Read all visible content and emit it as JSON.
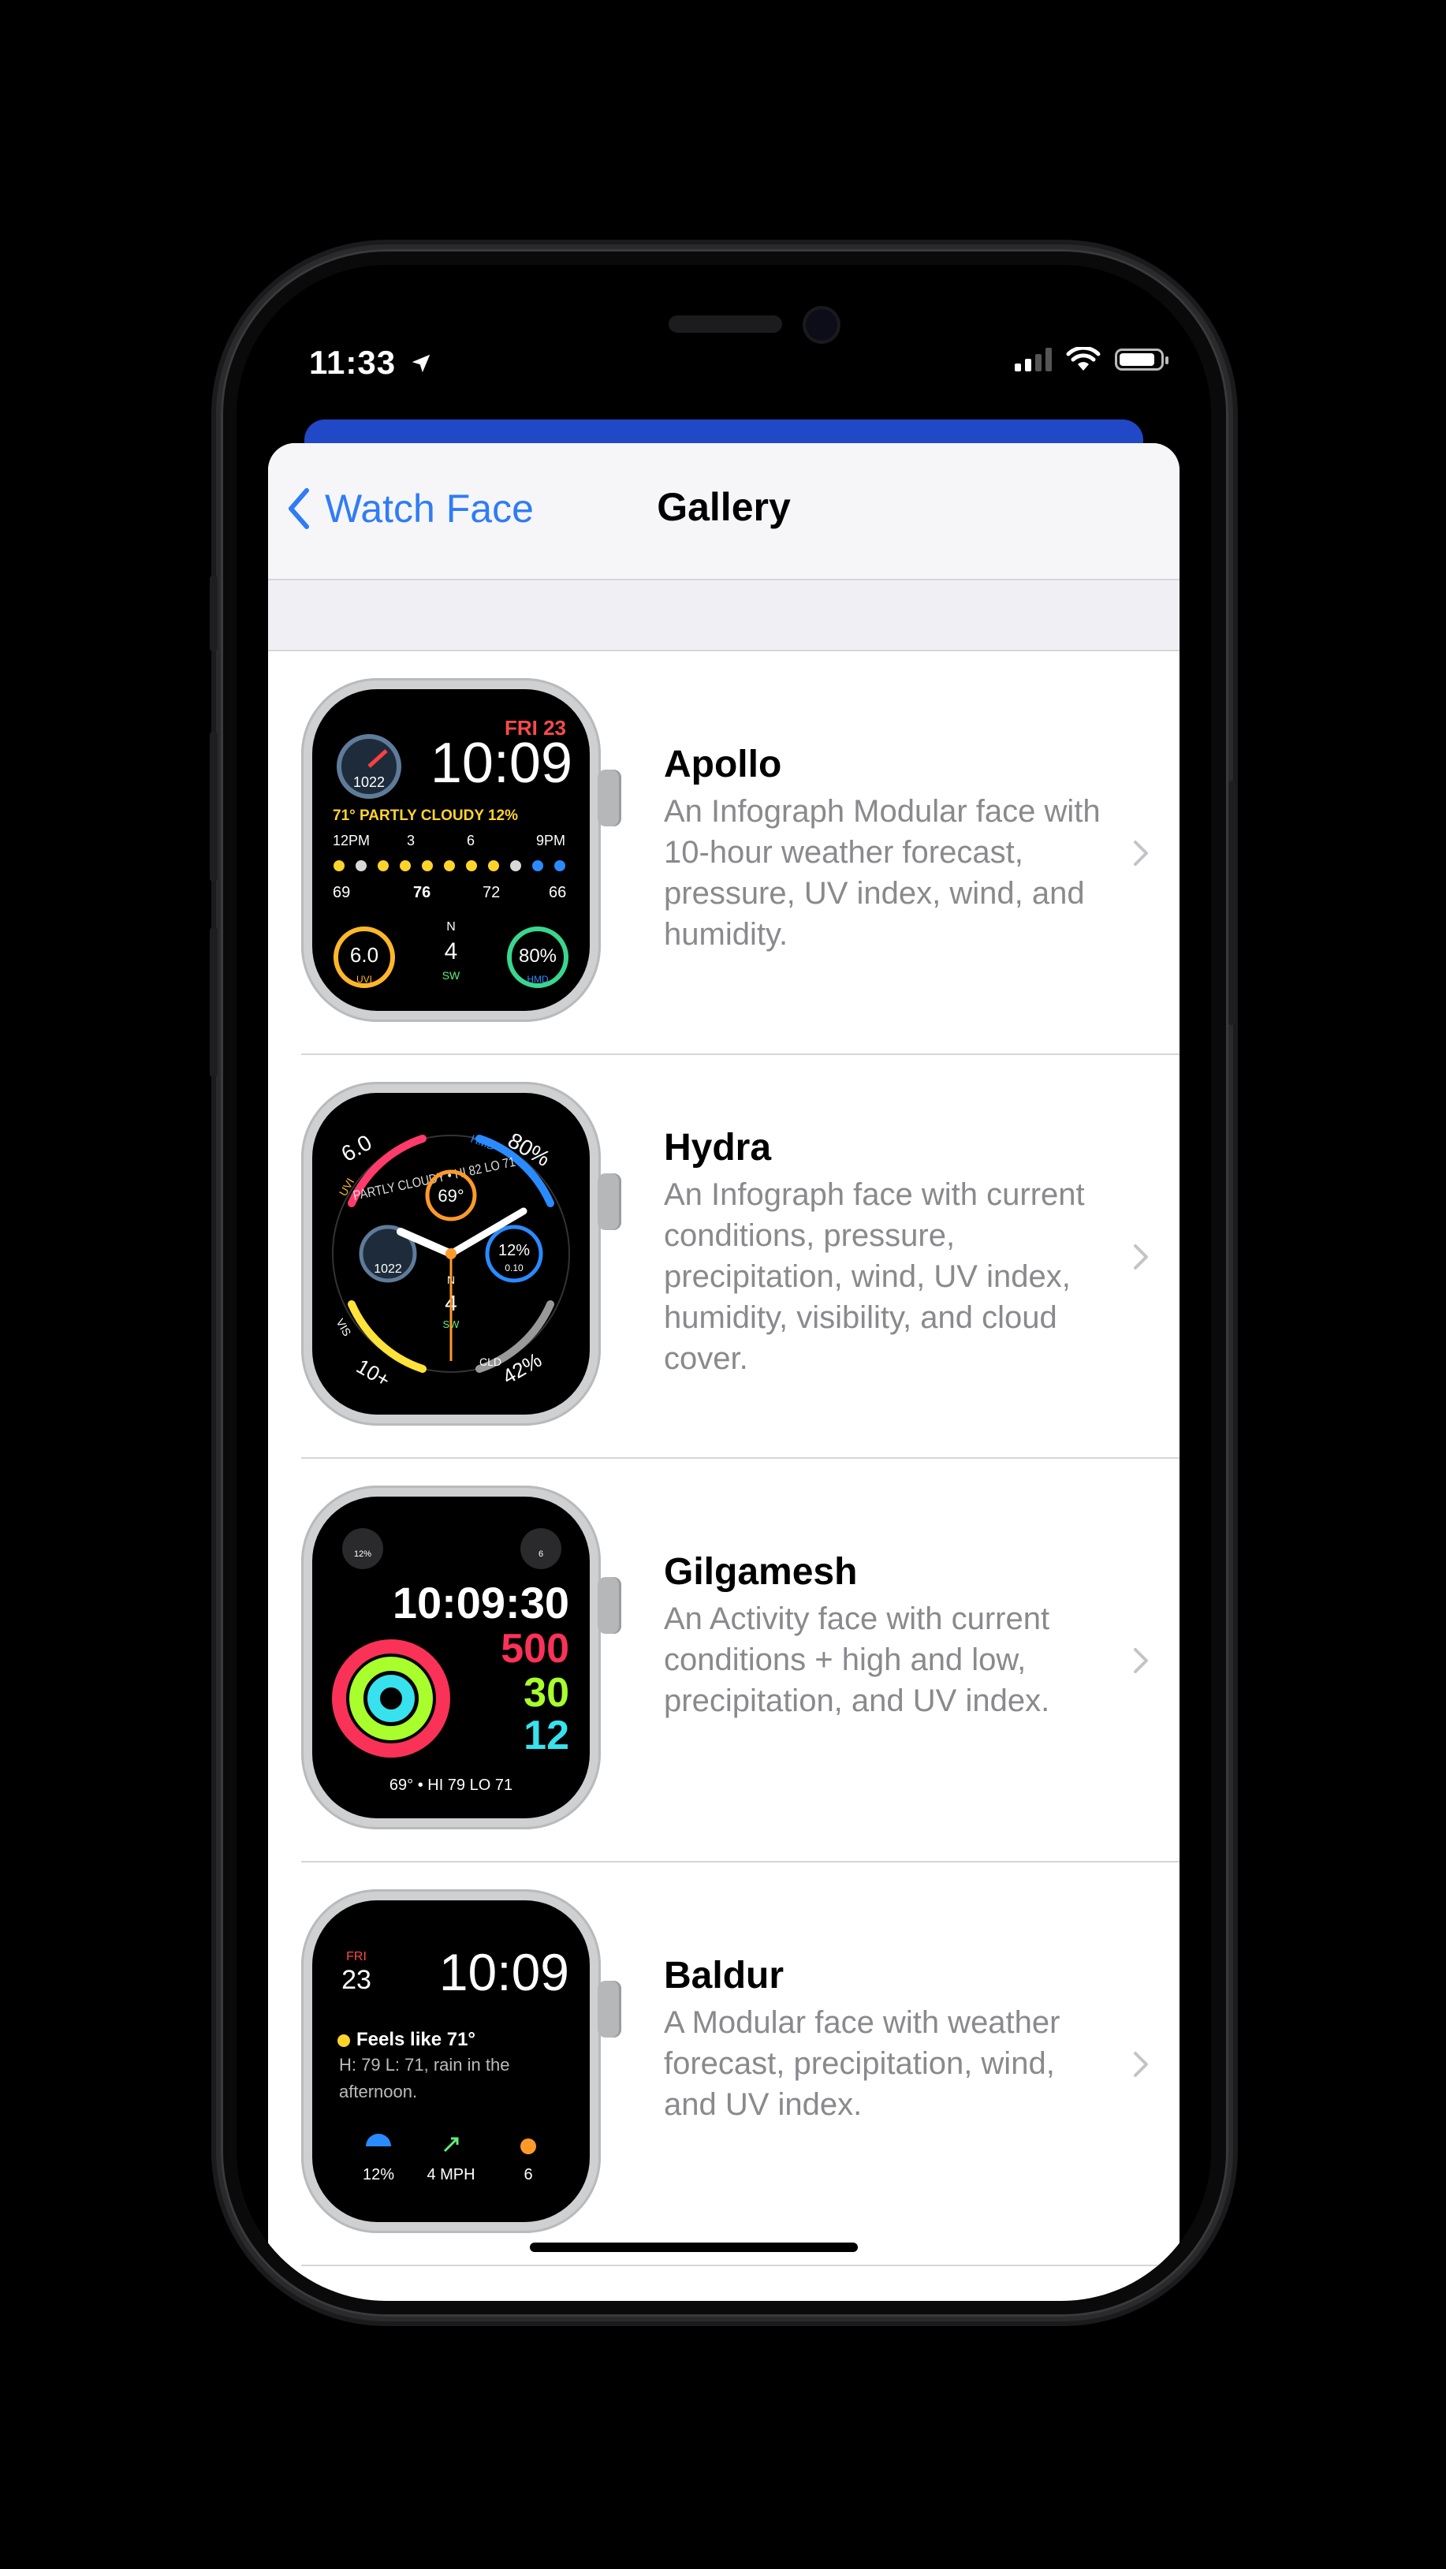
{
  "status_bar": {
    "time": "11:33"
  },
  "nav": {
    "back_label": "Watch Face",
    "title": "Gallery"
  },
  "faces": [
    {
      "title": "Apollo",
      "description": "An Infograph Modular face with 10-hour weather forecast, pressure, UV index, wind, and humidity.",
      "watch": {
        "date": "FRI 23",
        "time": "10:09",
        "pressure": "1022",
        "condition": "71° PARTLY CLOUDY 12%",
        "hours": [
          "12PM",
          "3",
          "6",
          "9PM"
        ],
        "temps": [
          "69",
          "76",
          "72",
          "66"
        ],
        "uv": "6.0",
        "uv_label": "UVI",
        "wind": "4",
        "wind_dir": "SW",
        "humidity": "80%",
        "humidity_label": "HMD",
        "compass_n": "N"
      }
    },
    {
      "title": "Hydra",
      "description": "An Infograph face with current conditions, pressure, precipitation, wind, UV index, humidity, visibility, and cloud cover.",
      "watch": {
        "uv": "6.0",
        "humidity": "80%",
        "arc_text": "PARTLY CLOUDY • HI 82 LO 71",
        "temp": "69°",
        "pressure": "1022",
        "precip": "12%",
        "precip_sub": "0.10",
        "wind": "4",
        "wind_dir": "SW",
        "visibility": "10+",
        "cloud": "42%",
        "uv_label": "UVI",
        "hmd_label": "HMD",
        "vis_label": "VIS",
        "cld_label": "CLD",
        "compass_n": "N"
      }
    },
    {
      "title": "Gilgamesh",
      "description": "An Activity face with current conditions + high and low, precipitation, and UV index.",
      "watch": {
        "time": "10:09:30",
        "move": "500",
        "exercise": "30",
        "stand": "12",
        "precip": "12%",
        "uv": "6",
        "weather": "69° • HI 79 LO 71"
      }
    },
    {
      "title": "Baldur",
      "description": "A Modular face with weather forecast, precipitation, wind, and UV index.",
      "watch": {
        "day": "FRI",
        "date": "23",
        "time": "10:09",
        "feels": "Feels like 71°",
        "forecast": "H: 79 L: 71, rain in the afternoon.",
        "precip": "12%",
        "wind": "4 MPH",
        "uv": "6"
      }
    }
  ],
  "colors": {
    "accent": "#2f7cf6",
    "move": "#fa3257",
    "exercise": "#a8ff2c",
    "stand": "#37e2ee"
  }
}
